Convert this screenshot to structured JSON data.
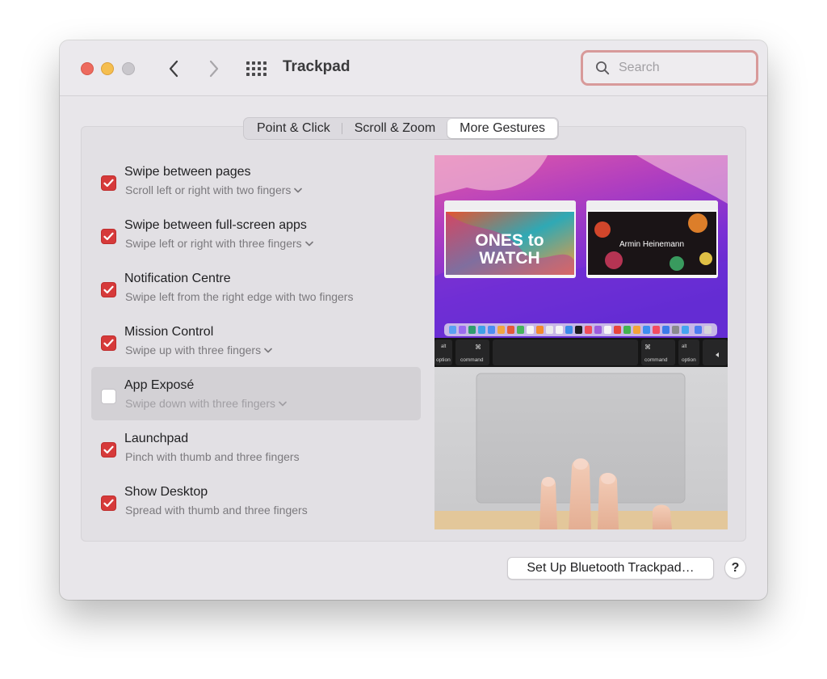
{
  "window": {
    "title": "Trackpad"
  },
  "search": {
    "placeholder": "Search",
    "value": ""
  },
  "tabs": [
    {
      "label": "Point & Click",
      "active": false
    },
    {
      "label": "Scroll & Zoom",
      "active": false
    },
    {
      "label": "More Gestures",
      "active": true
    }
  ],
  "gestures": [
    {
      "title": "Swipe between pages",
      "subtitle": "Scroll left or right with two fingers",
      "checked": true,
      "has_menu": true
    },
    {
      "title": "Swipe between full-screen apps",
      "subtitle": "Swipe left or right with three fingers",
      "checked": true,
      "has_menu": true
    },
    {
      "title": "Notification Centre",
      "subtitle": "Swipe left from the right edge with two fingers",
      "checked": true,
      "has_menu": false
    },
    {
      "title": "Mission Control",
      "subtitle": "Swipe up with three fingers",
      "checked": true,
      "has_menu": true
    },
    {
      "title": "App Exposé",
      "subtitle": "Swipe down with three fingers",
      "checked": false,
      "has_menu": true,
      "selected": true
    },
    {
      "title": "Launchpad",
      "subtitle": "Pinch with thumb and three fingers",
      "checked": true,
      "has_menu": false
    },
    {
      "title": "Show Desktop",
      "subtitle": "Spread with thumb and three fingers",
      "checked": true,
      "has_menu": false
    }
  ],
  "preview": {
    "left_card_text_1": "ONES to",
    "left_card_text_2": "WATCH",
    "right_card_text": "Armin Heinemann",
    "keys": {
      "left_option": "option",
      "left_command": "command",
      "right_command": "command",
      "right_option": "option",
      "alt_left": "alt",
      "alt_right": "alt"
    }
  },
  "footer": {
    "setup_button": "Set Up Bluetooth Trackpad…",
    "help_button": "?"
  },
  "colors": {
    "accent_checkbox": "#d63a3a",
    "search_focus_ring": "#d89a9a",
    "window_bg": "#e8e6ea"
  },
  "icons": {
    "back": "chevron-left-icon",
    "forward": "chevron-right-icon",
    "grid": "grid-icon",
    "search": "search-icon",
    "checkmark": "checkmark-icon",
    "dropdown": "chevron-down-icon"
  }
}
